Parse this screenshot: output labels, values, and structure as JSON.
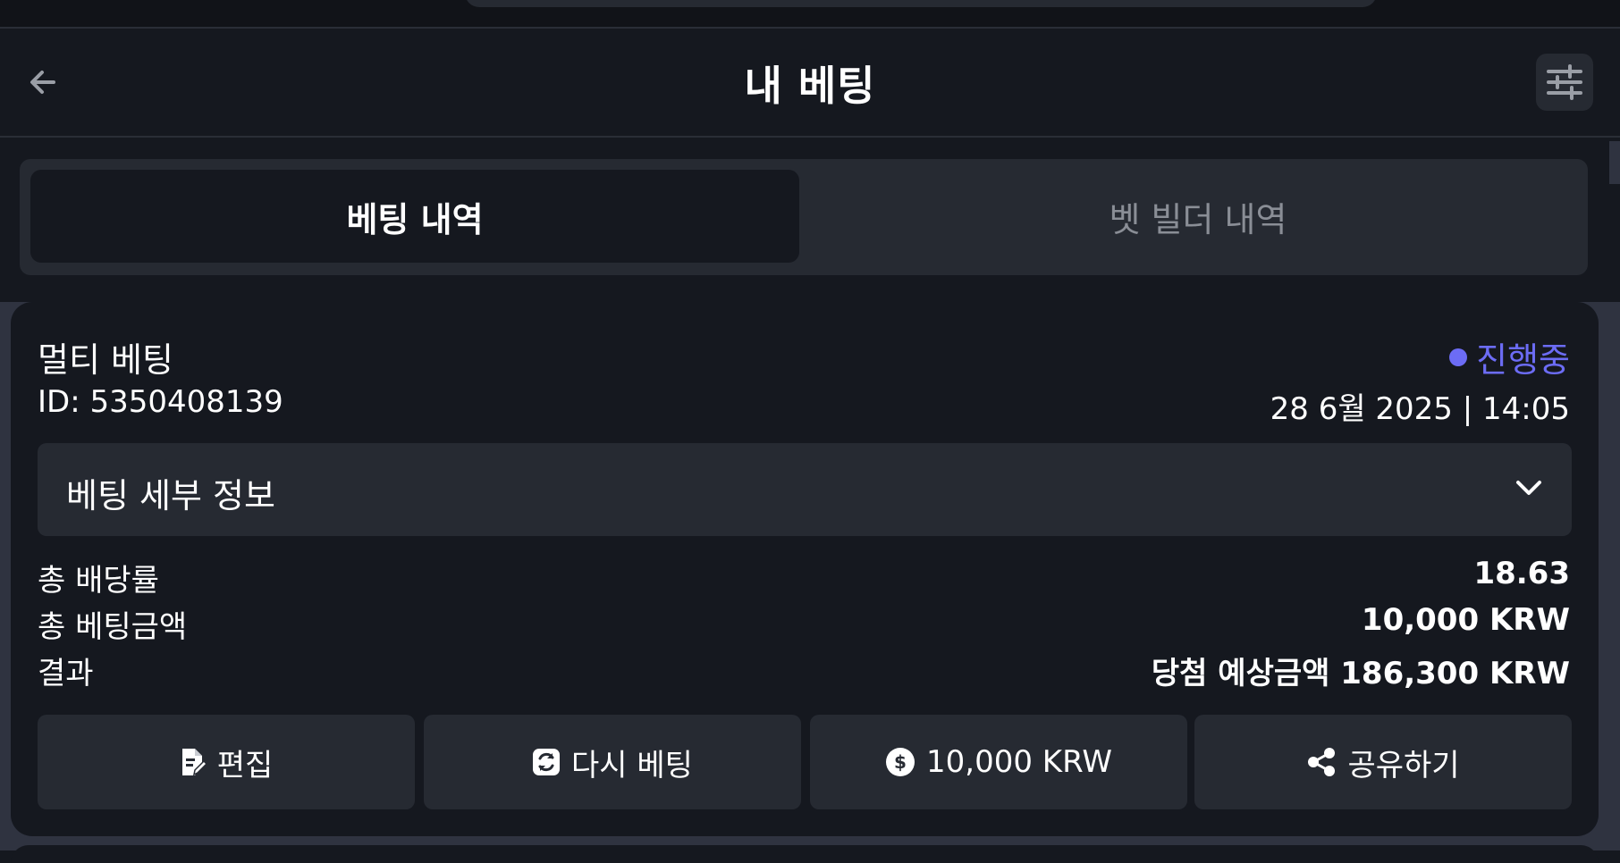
{
  "header": {
    "title": "내 베팅",
    "back_icon": "arrow-left-icon",
    "filter_icon": "sliders-icon"
  },
  "tabs": [
    {
      "label": "베팅 내역",
      "active": true
    },
    {
      "label": "벳 빌더 내역",
      "active": false
    }
  ],
  "bet": {
    "type": "멀티 베팅",
    "status": "진행중",
    "id": "ID: 5350408139",
    "datetime": "28 6월 2025 | 14:05",
    "details_label": "베팅 세부 정보",
    "rows": [
      {
        "label": "총 배당률",
        "value": "18.63"
      },
      {
        "label": "총 베팅금액",
        "value": "10,000 KRW"
      },
      {
        "label": "결과",
        "value": "당첨 예상금액 186,300 KRW"
      }
    ],
    "actions": [
      {
        "label": "편집",
        "icon": "edit-document-icon"
      },
      {
        "label": "다시 베팅",
        "icon": "refresh-icon"
      },
      {
        "label": "10,000 KRW",
        "icon": "dollar-coin-icon"
      },
      {
        "label": "공유하기",
        "icon": "share-icon"
      }
    ]
  },
  "colors": {
    "background": "#15181f",
    "surface": "#262a32",
    "status_accent": "#6c6cf5",
    "muted_text": "#8a8e96"
  }
}
